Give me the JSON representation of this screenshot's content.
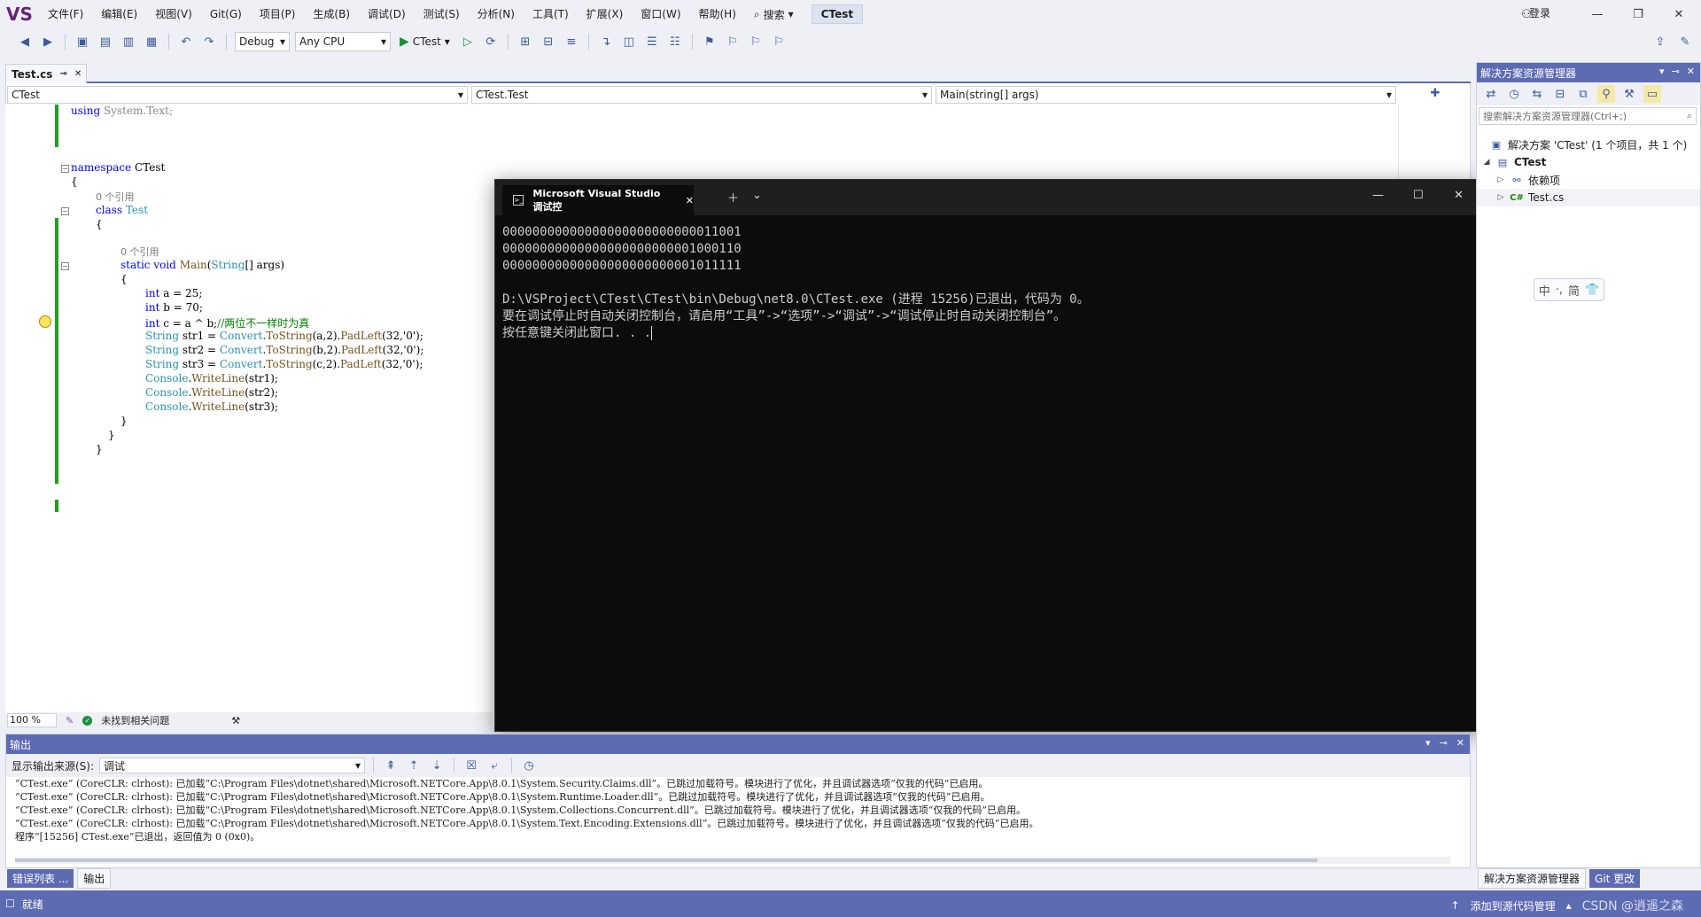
{
  "menubar": {
    "logo": "VS",
    "items": [
      "文件(F)",
      "编辑(E)",
      "视图(V)",
      "Git(G)",
      "项目(P)",
      "生成(B)",
      "调试(D)",
      "测试(S)",
      "分析(N)",
      "工具(T)",
      "扩展(X)",
      "窗口(W)",
      "帮助(H)"
    ],
    "search": "搜索",
    "solution_name": "CTest",
    "login": "登录"
  },
  "toolbar": {
    "config": "Debug",
    "platform": "Any CPU",
    "run_target": "CTest"
  },
  "editor": {
    "tab_title": "Test.cs",
    "nav_project": "CTest",
    "nav_class": "CTest.Test",
    "nav_member": "Main(string[] args)",
    "zoom": "100 %",
    "issues": "未找到相关问题",
    "refs_class": "0 个引用",
    "refs_method": "0 个引用"
  },
  "console": {
    "tab_title": "Microsoft Visual Studio 调试控",
    "lines": [
      "00000000000000000000000000011001",
      "00000000000000000000000001000110",
      "00000000000000000000000001011111",
      "",
      "D:\\VSProject\\CTest\\CTest\\bin\\Debug\\net8.0\\CTest.exe (进程 15256)已退出，代码为 0。",
      "要在调试停止时自动关闭控制台，请启用“工具”->“选项”->“调试”->“调试停止时自动关闭控制台”。",
      "按任意键关闭此窗口. . ."
    ]
  },
  "output": {
    "title": "输出",
    "source_label": "显示输出来源(S):",
    "source_value": "调试",
    "lines": [
      "“CTest.exe” (CoreCLR: clrhost): 已加载“C:\\Program Files\\dotnet\\shared\\Microsoft.NETCore.App\\8.0.1\\System.Security.Claims.dll”。已跳过加载符号。模块进行了优化，并且调试器选项“仅我的代码”已启用。",
      "“CTest.exe” (CoreCLR: clrhost): 已加载“C:\\Program Files\\dotnet\\shared\\Microsoft.NETCore.App\\8.0.1\\System.Runtime.Loader.dll”。已跳过加载符号。模块进行了优化，并且调试器选项“仅我的代码”已启用。",
      "“CTest.exe” (CoreCLR: clrhost): 已加载“C:\\Program Files\\dotnet\\shared\\Microsoft.NETCore.App\\8.0.1\\System.Collections.Concurrent.dll”。已跳过加载符号。模块进行了优化，并且调试器选项“仅我的代码”已启用。",
      "“CTest.exe” (CoreCLR: clrhost): 已加载“C:\\Program Files\\dotnet\\shared\\Microsoft.NETCore.App\\8.0.1\\System.Text.Encoding.Extensions.dll”。已跳过加载符号。模块进行了优化，并且调试器选项“仅我的代码”已启用。",
      "程序“[15256] CTest.exe”已退出，返回值为 0 (0x0)。"
    ]
  },
  "bottom_tabs": [
    "错误列表 ...",
    "输出"
  ],
  "solution_explorer": {
    "title": "解决方案资源管理器",
    "search_placeholder": "搜索解决方案资源管理器(Ctrl+;)",
    "root": "解决方案 'CTest' (1 个项目，共 1 个)",
    "project": "CTest",
    "dependencies": "依赖项",
    "file": "Test.cs",
    "bottom_tabs": [
      "解决方案资源管理器",
      "Git 更改"
    ]
  },
  "ime": {
    "mode": "中",
    "punct": "·,",
    "script": "简"
  },
  "statusbar": {
    "ready": "就绪",
    "add_source_control": "添加到源代码管理",
    "watermark": "CSDN @逍遥之森"
  }
}
